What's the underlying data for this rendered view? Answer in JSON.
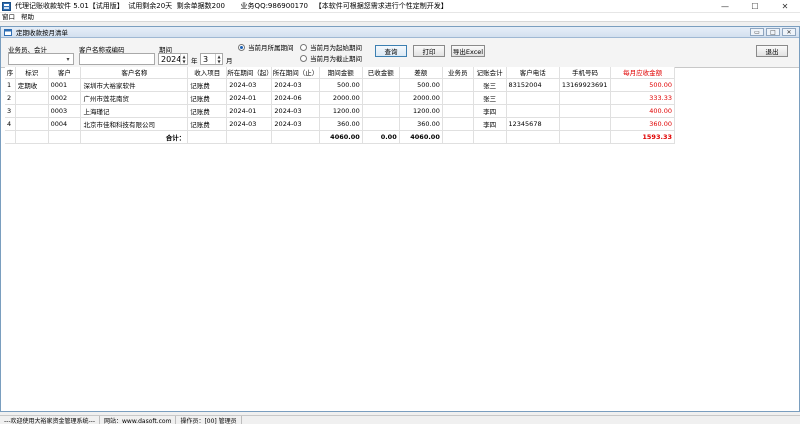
{
  "window": {
    "title": "代理记账收款软件 5.01【试用版】  试用剩余20天  剩余单据数200       业务QQ:986900170   【本软件可根据您需求进行个性定制开发】",
    "minimize": "—",
    "maximize": "☐",
    "close": "✕"
  },
  "menu": [
    "窗口",
    "帮助"
  ],
  "child": {
    "title": "定期收款按月清单",
    "buttons": [
      "▭",
      "□",
      "✕"
    ]
  },
  "filter": {
    "salesperson_label": "业务员、会计",
    "salesperson_value": "",
    "customer_label": "客户名称或编码",
    "customer_value": "",
    "period_label": "期间",
    "year": "2024",
    "year_unit": "年",
    "month": "3",
    "month_unit": "月",
    "radios": [
      {
        "label": "当前月所属期间",
        "checked": true
      },
      {
        "label": "当前月为起始期间",
        "checked": false
      },
      {
        "label": "当前月为截止期间",
        "checked": false
      }
    ],
    "query_label": "查询",
    "print_label": "打印",
    "export_label": "导出Excel",
    "exit_label": "退出"
  },
  "table": {
    "headers": [
      "序",
      "标识",
      "客户",
      "客户名称",
      "收入项目",
      "所在期间（起）",
      "所在期间（止）",
      "期间金额",
      "已收金额",
      "差额",
      "业务员",
      "记账会计",
      "客户电话",
      "手机号码",
      "每月应收金额"
    ],
    "rows": [
      {
        "seq": "1",
        "flag": "定期收",
        "code": "0001",
        "name": "深圳市大裕家软件",
        "item": "记账费",
        "start": "2024-03",
        "end": "2024-03",
        "amount": "500.00",
        "received": "",
        "diff": "500.00",
        "sales": "",
        "accountant": "张三",
        "phone": "83152004",
        "mobile": "13169923691",
        "monthly": "500.00"
      },
      {
        "seq": "2",
        "flag": "",
        "code": "0002",
        "name": "广州市莲花南贸",
        "item": "记账费",
        "start": "2024-01",
        "end": "2024-06",
        "amount": "2000.00",
        "received": "",
        "diff": "2000.00",
        "sales": "",
        "accountant": "张三",
        "phone": "",
        "mobile": "",
        "monthly": "333.33"
      },
      {
        "seq": "3",
        "flag": "",
        "code": "0003",
        "name": "上海瑾记",
        "item": "记账费",
        "start": "2024-01",
        "end": "2024-03",
        "amount": "1200.00",
        "received": "",
        "diff": "1200.00",
        "sales": "",
        "accountant": "李四",
        "phone": "",
        "mobile": "",
        "monthly": "400.00"
      },
      {
        "seq": "4",
        "flag": "",
        "code": "0004",
        "name": "北京市佳和科技有限公司",
        "item": "记账费",
        "start": "2024-03",
        "end": "2024-03",
        "amount": "360.00",
        "received": "",
        "diff": "360.00",
        "sales": "",
        "accountant": "李四",
        "phone": "12345678",
        "mobile": "",
        "monthly": "360.00"
      }
    ],
    "total": {
      "label": "合计：",
      "amount": "4060.00",
      "received": "0.00",
      "diff": "4060.00",
      "monthly": "1593.33"
    }
  },
  "status": [
    "---欢迎使用大裕家资金管理系统---",
    "网站：www.dasoft.com",
    "操作员：[00] 管理员"
  ],
  "colors": {
    "monthly_header": "#e00000",
    "monthly_values": "#e00000",
    "window_frame": "#7a9ebf"
  }
}
